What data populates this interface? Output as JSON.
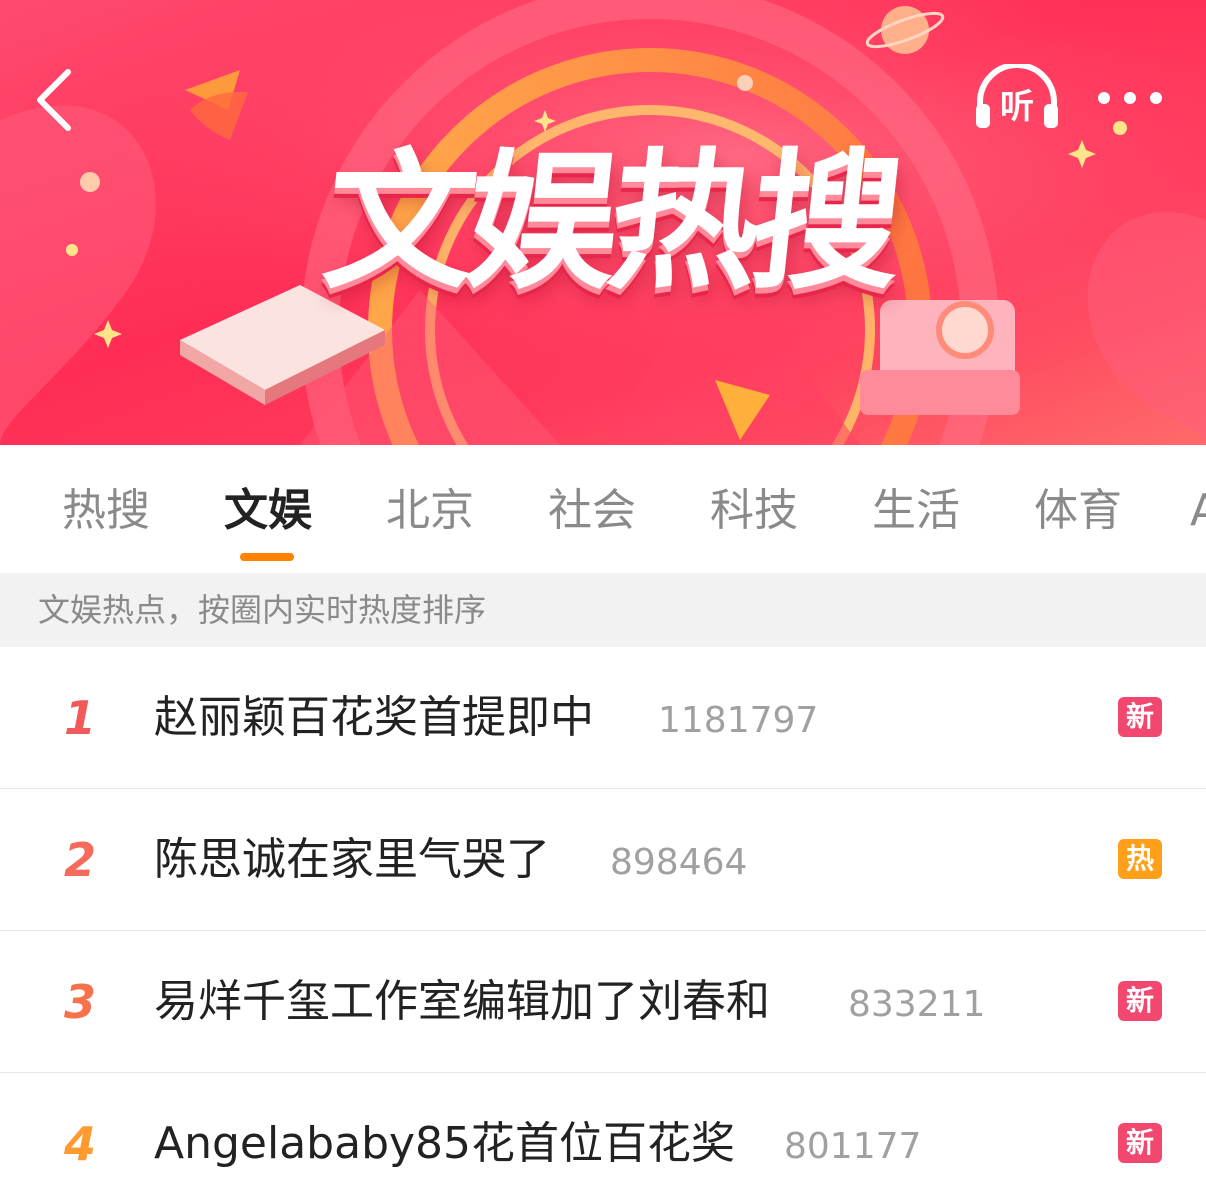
{
  "header": {
    "title": "文娱热搜",
    "back_icon": "chevron-left-icon",
    "listen_label": "听",
    "listen_icon": "headphones-icon",
    "more_icon": "more-dots-icon"
  },
  "tabs": [
    {
      "label": "热搜",
      "active": false
    },
    {
      "label": "文娱",
      "active": true
    },
    {
      "label": "北京",
      "active": false
    },
    {
      "label": "社会",
      "active": false
    },
    {
      "label": "科技",
      "active": false
    },
    {
      "label": "生活",
      "active": false
    },
    {
      "label": "体育",
      "active": false
    },
    {
      "label": "A",
      "active": false
    }
  ],
  "notice": "文娱热点，按圈内实时热度排序",
  "items": [
    {
      "rank": "1",
      "title": "赵丽颖百花奖首提即中",
      "count": "1181797",
      "badge": "新",
      "badge_color": "#f2476e",
      "rank_color": "#f25a5a"
    },
    {
      "rank": "2",
      "title": "陈思诚在家里气哭了",
      "count": "898464",
      "badge": "热",
      "badge_color": "#ff9f1a",
      "rank_color": "#f56a5a"
    },
    {
      "rank": "3",
      "title": "易烊千玺工作室编辑加了刘春和",
      "count": "833211",
      "badge": "新",
      "badge_color": "#f2476e",
      "rank_color": "#f5724a"
    },
    {
      "rank": "4",
      "title": "Angelababy85花首位百花奖",
      "count": "801177",
      "badge": "新",
      "badge_color": "#f2476e",
      "rank_color": "#ff9a2e"
    }
  ],
  "colors": {
    "accent": "#ff8200",
    "banner": "#ff2d55",
    "badge_new": "#f2476e",
    "badge_hot": "#ff9f1a"
  }
}
